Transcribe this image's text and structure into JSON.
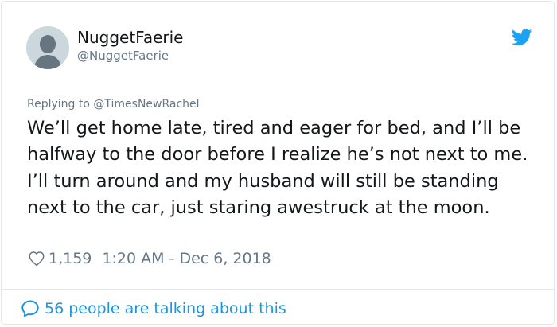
{
  "author": {
    "display_name": "NuggetFaerie",
    "handle": "@NuggetFaerie"
  },
  "icons": {
    "avatar": "default-avatar-silhouette",
    "brand": "twitter-bird-icon",
    "like": "heart-outline-icon",
    "conversation": "speech-bubble-icon"
  },
  "reply": {
    "prefix": "Replying to",
    "mention": "@TimesNewRachel"
  },
  "tweet": {
    "text": "We’ll get home late, tired and eager for bed, and I’ll be halfway to the door before I realize he’s not next to me. I’ll turn around and my husband will still be standing next to the car, just staring awestruck at the moon."
  },
  "meta": {
    "likes": "1,159",
    "timestamp": "1:20 AM - Dec 6, 2018"
  },
  "footer": {
    "conversation_label": "56 people are talking about this"
  },
  "colors": {
    "twitter_blue": "#1da1f2",
    "link_blue": "#1b95e0",
    "secondary_text": "#657786",
    "primary_text": "#14171a",
    "border": "#e1e8ed"
  }
}
